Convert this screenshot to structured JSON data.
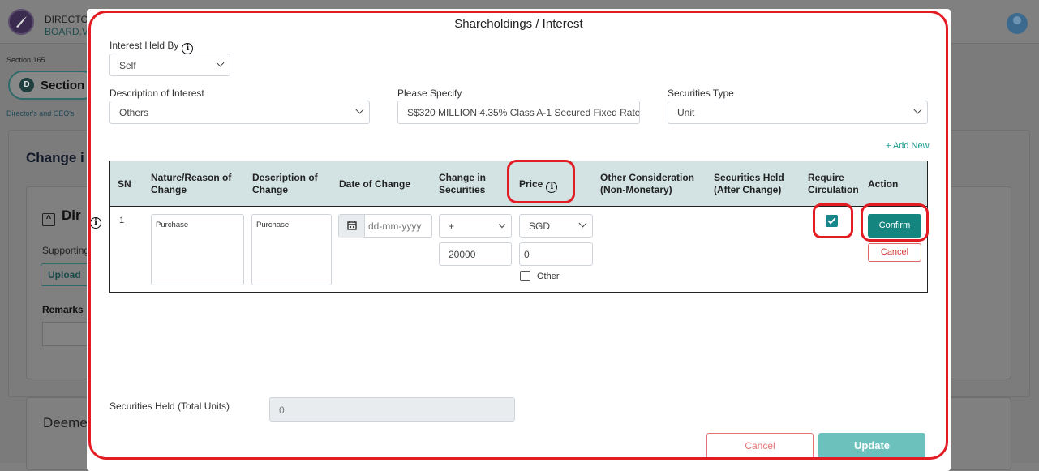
{
  "background": {
    "app_title": "DIRECTO",
    "app_subtitle": "BOARD.VI",
    "section_label": "Section 165",
    "section_pill_letter": "D",
    "section_pill_text": "Section",
    "breadcrumb": "Director's and CEO's",
    "card_title": "Change i",
    "inner_title": "Dir",
    "inner_toggle": "^",
    "supporting": "Supporting",
    "upload": "Upload",
    "remarks": "Remarks",
    "deemed": "Deeme"
  },
  "modal": {
    "title": "Shareholdings / Interest",
    "interest_held_by": {
      "label": "Interest Held By",
      "value": "Self"
    },
    "description_of_interest": {
      "label": "Description of Interest",
      "value": "Others"
    },
    "please_specify": {
      "label": "Please Specify",
      "value": "S$320 MILLION 4.35% Class A-1 Secured Fixed Rate"
    },
    "securities_type": {
      "label": "Securities Type",
      "value": "Unit"
    },
    "add_new": "+ Add New",
    "table": {
      "headers": {
        "sn": "SN",
        "nature_1": "Nature/Reason of",
        "nature_2": "Change",
        "desc_1": "Description of",
        "desc_2": "Change",
        "date": "Date of Change",
        "change_1": "Change in",
        "change_2": "Securities",
        "price": "Price",
        "other_1": "Other Consideration",
        "other_2": "(Non-Monetary)",
        "held_1": "Securities Held",
        "held_2": "(After Change)",
        "req_1": "Require",
        "req_2": "Circulation",
        "action": "Action"
      },
      "row": {
        "sn": "1",
        "nature": "Purchase",
        "description": "Purchase",
        "date_placeholder": "dd-mm-yyyy",
        "change_sign": "+",
        "change_amount": "20000",
        "currency": "SGD",
        "price_value": "0",
        "other_label": "Other",
        "require_circulation": true,
        "confirm": "Confirm",
        "cancel": "Cancel"
      }
    },
    "securities_held_total": {
      "label": "Securities Held (Total Units)",
      "value": "0"
    },
    "cancel": "Cancel",
    "update": "Update"
  },
  "colors": {
    "accent": "#15857f",
    "highlight": "#e31b23",
    "table_header": "#d3e3e3"
  }
}
